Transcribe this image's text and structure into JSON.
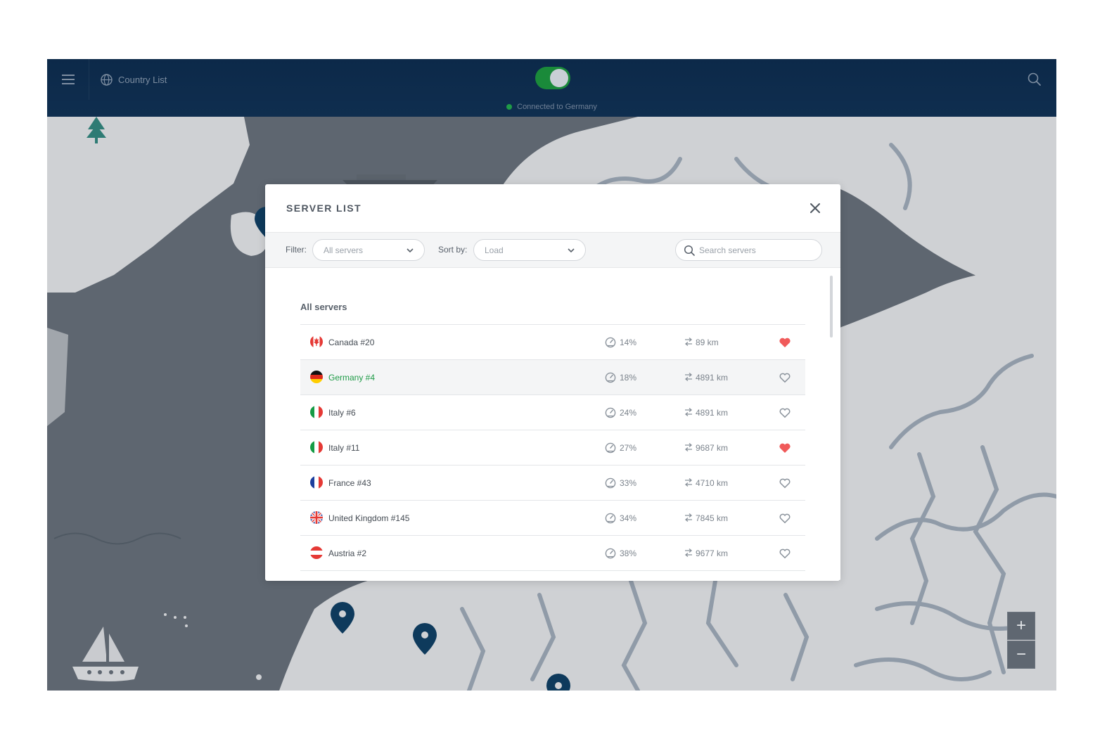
{
  "header": {
    "country_list_label": "Country List",
    "status_text": "Connected to Germany",
    "vpn_on": true
  },
  "modal": {
    "title": "SERVER LIST",
    "filter_label": "Filter:",
    "filter_value": "All servers",
    "sort_label": "Sort by:",
    "sort_value": "Load",
    "search_placeholder": "Search servers",
    "section_title": "All servers",
    "servers": [
      {
        "name": "Canada #20",
        "load": "14%",
        "distance": "89 km",
        "favorite": true,
        "flag": "canada-flag-icon"
      },
      {
        "name": "Germany #4",
        "load": "18%",
        "distance": "4891 km",
        "favorite": false,
        "flag": "germany-flag-icon",
        "active": true
      },
      {
        "name": "Italy #6",
        "load": "24%",
        "distance": "4891 km",
        "favorite": false,
        "flag": "italy-flag-icon"
      },
      {
        "name": "Italy #11",
        "load": "27%",
        "distance": "9687 km",
        "favorite": true,
        "flag": "italy-flag-icon"
      },
      {
        "name": "France #43",
        "load": "33%",
        "distance": "4710 km",
        "favorite": false,
        "flag": "france-flag-icon"
      },
      {
        "name": "United Kingdom #145",
        "load": "34%",
        "distance": "7845 km",
        "favorite": false,
        "flag": "uk-flag-icon"
      },
      {
        "name": "Austria #2",
        "load": "38%",
        "distance": "9677 km",
        "favorite": false,
        "flag": "austria-flag-icon"
      }
    ]
  },
  "zoom": {
    "in_label": "+",
    "out_label": "−"
  },
  "colors": {
    "topbar": "#0c2949",
    "map_water": "#5e6670",
    "map_land": "#cfd1d4",
    "connected_green": "#1f9b47",
    "favorite_red": "#f05a5a",
    "pin": "#0e3a5c"
  }
}
